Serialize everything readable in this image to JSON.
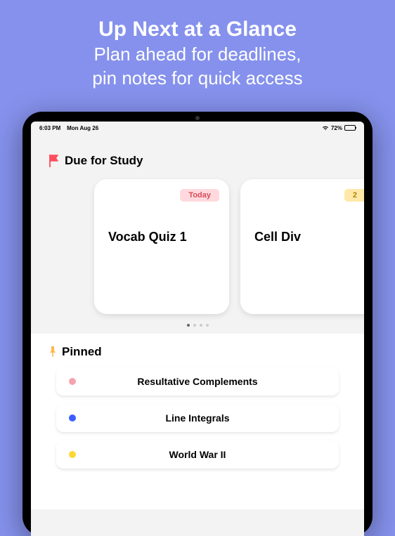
{
  "hero": {
    "title": "Up Next at a Glance",
    "subtitle_line1": "Plan ahead for deadlines,",
    "subtitle_line2": "pin notes for quick access"
  },
  "statusBar": {
    "time": "6:03 PM",
    "date": "Mon Aug 26",
    "battery": "72%"
  },
  "dueSection": {
    "title": "Due for Study",
    "cards": [
      {
        "badge": "Today",
        "title": "Vocab Quiz 1"
      },
      {
        "badge": "2",
        "title": "Cell Div"
      }
    ]
  },
  "pinnedSection": {
    "title": "Pinned",
    "items": [
      {
        "color": "#f5a3ad",
        "label": "Resultative Complements"
      },
      {
        "color": "#3d5cff",
        "label": "Line Integrals"
      },
      {
        "color": "#ffd633",
        "label": "World War II"
      }
    ]
  }
}
